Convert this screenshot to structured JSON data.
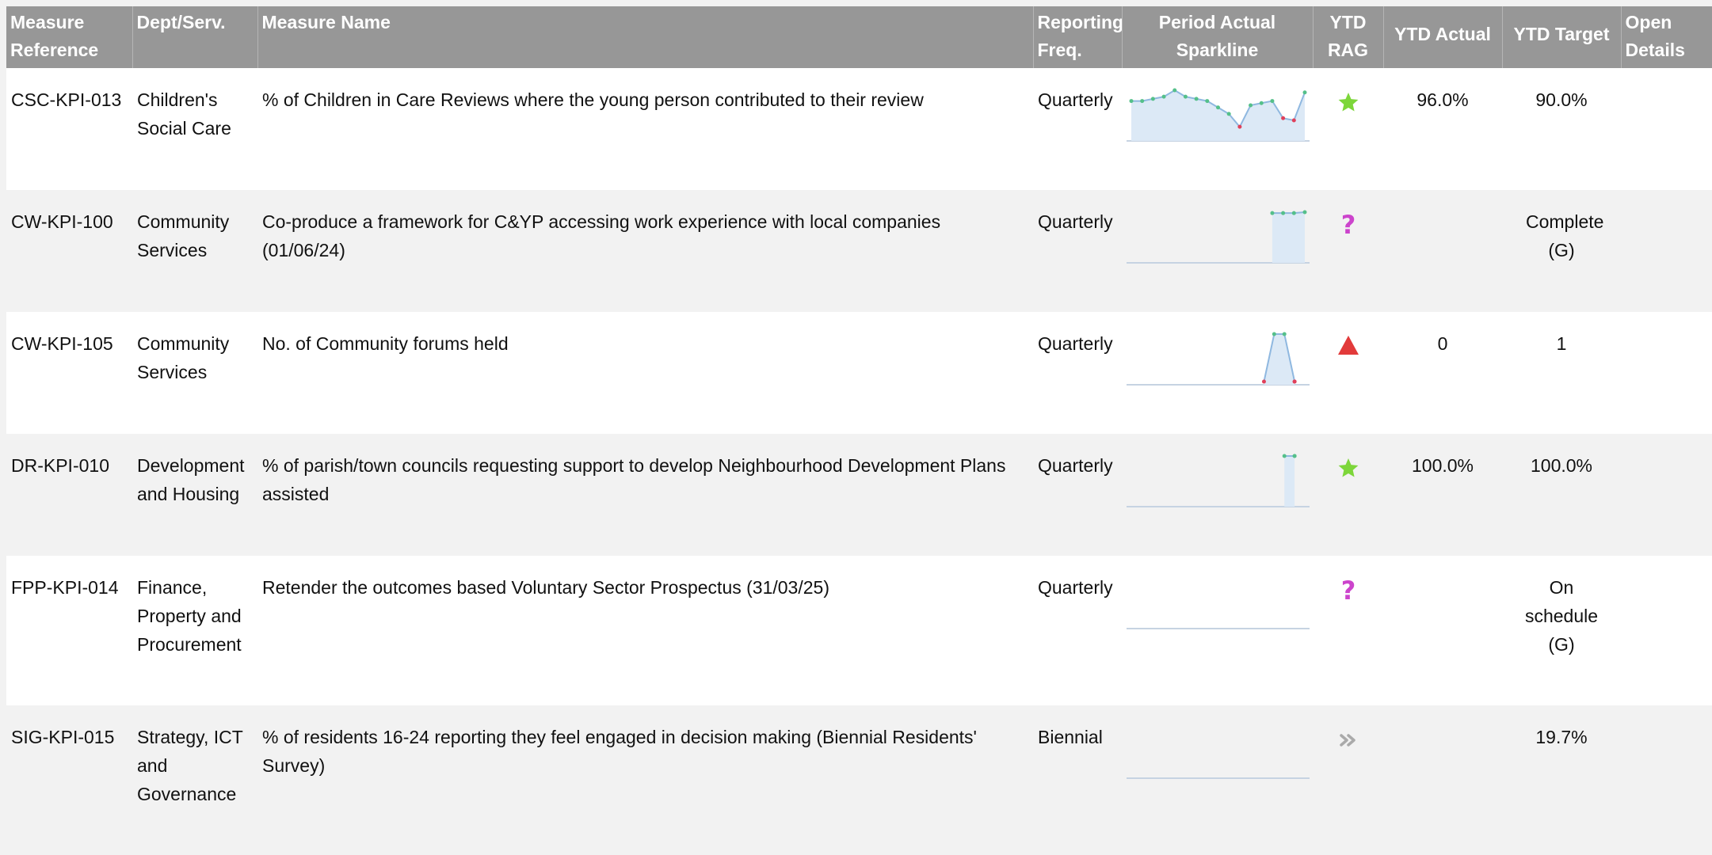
{
  "columns": {
    "ref": "Measure Reference",
    "dept": "Dept/Serv.",
    "name": "Measure Name",
    "freq": "Reporting Freq.",
    "spark": "Period Actual Sparkline",
    "rag": "YTD RAG",
    "actual": "YTD Actual",
    "target": "YTD Target",
    "open": "Open Details"
  },
  "colors": {
    "header_bg": "#979797",
    "row_alt_bg": "#f2f2f2",
    "spark_fill": "#dce9f6",
    "spark_line": "#8fb8e0",
    "marker_green": "#55c08a",
    "marker_red": "#e0405a",
    "rag_green": "#7dd63a",
    "rag_red": "#e23a3a",
    "rag_unknown": "#cc44cc",
    "rag_grey": "#aaaaaa"
  },
  "rows": [
    {
      "ref": "CSC-KPI-013",
      "dept": "Children's Social Care",
      "name": "% of Children in Care Reviews where the young person contributed to their review",
      "freq": "Quarterly",
      "rag_icon": "green-star-icon",
      "ytd_actual": "96.0%",
      "ytd_target": "90.0%",
      "sparkline": {
        "values": [
          96,
          96,
          96.5,
          97,
          98.5,
          97,
          96.5,
          96,
          94.5,
          93,
          90,
          95,
          95.5,
          96,
          92,
          91.5,
          98
        ],
        "marker_colors": [
          "g",
          "g",
          "g",
          "g",
          "g",
          "g",
          "g",
          "g",
          "g",
          "g",
          "r",
          "g",
          "g",
          "g",
          "r",
          "r",
          "g"
        ]
      }
    },
    {
      "ref": "CW-KPI-100",
      "dept": "Community Services",
      "name": "Co-produce a framework for C&YP accessing work experience with local companies (01/06/24)",
      "freq": "Quarterly",
      "rag_icon": "purple-question-icon",
      "ytd_actual": "",
      "ytd_target": "Complete (G)",
      "sparkline": {
        "values": [
          null,
          null,
          null,
          null,
          null,
          null,
          null,
          null,
          null,
          null,
          null,
          null,
          null,
          100,
          100,
          100,
          102
        ],
        "marker_colors": [
          "",
          "",
          "",
          "",
          "",
          "",
          "",
          "",
          "",
          "",
          "",
          "",
          "",
          "g",
          "g",
          "g",
          "g"
        ]
      }
    },
    {
      "ref": "CW-KPI-105",
      "dept": "Community Services",
      "name": "No. of Community forums held",
      "freq": "Quarterly",
      "rag_icon": "red-triangle-icon",
      "ytd_actual": "0",
      "ytd_target": "1",
      "sparkline": {
        "values": [
          null,
          null,
          null,
          null,
          null,
          null,
          null,
          null,
          null,
          null,
          null,
          null,
          null,
          0,
          1,
          1,
          0,
          0
        ],
        "marker_colors": [
          "",
          "",
          "",
          "",
          "",
          "",
          "",
          "",
          "",
          "",
          "",
          "",
          "",
          "r",
          "g",
          "g",
          "r",
          "r"
        ]
      }
    },
    {
      "ref": "DR-KPI-010",
      "dept": "Development and Housing",
      "name": "% of parish/town councils requesting support to develop Neighbourhood Development Plans assisted",
      "freq": "Quarterly",
      "rag_icon": "green-star-icon",
      "ytd_actual": "100.0%",
      "ytd_target": "100.0%",
      "sparkline": {
        "values": [
          null,
          null,
          null,
          null,
          null,
          null,
          null,
          null,
          null,
          null,
          null,
          null,
          null,
          null,
          null,
          100,
          100,
          100
        ],
        "marker_colors": [
          "",
          "",
          "",
          "",
          "",
          "",
          "",
          "",
          "",
          "",
          "",
          "",
          "",
          "",
          "",
          "g",
          "g",
          "g"
        ]
      }
    },
    {
      "ref": "FPP-KPI-014",
      "dept": "Finance, Property and Procurement",
      "name": "Retender the outcomes based Voluntary Sector Prospectus (31/03/25)",
      "freq": "Quarterly",
      "rag_icon": "purple-question-icon",
      "ytd_actual": "",
      "ytd_target": "On schedule (G)",
      "sparkline": {
        "values": [],
        "marker_colors": []
      }
    },
    {
      "ref": "SIG-KPI-015",
      "dept": "Strategy, ICT and Governance",
      "name": "% of residents 16-24 reporting they feel engaged in decision making (Biennial Residents' Survey)",
      "freq": "Biennial",
      "rag_icon": "grey-chevrons-icon",
      "ytd_actual": "",
      "ytd_target": "19.7%",
      "sparkline": {
        "values": [],
        "marker_colors": []
      }
    }
  ]
}
